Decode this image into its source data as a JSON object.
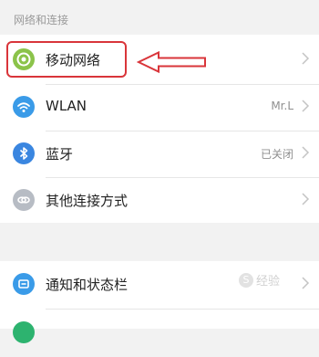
{
  "section": {
    "header": "网络和连接"
  },
  "rows": [
    {
      "label": "移动网络",
      "value": "",
      "icon": "mobile-network-icon",
      "color": "#8bc34a"
    },
    {
      "label": "WLAN",
      "value": "Mr.L",
      "icon": "wifi-icon",
      "color": "#3a9be8"
    },
    {
      "label": "蓝牙",
      "value": "已关闭",
      "icon": "bluetooth-icon",
      "color": "#3a86e0"
    },
    {
      "label": "其他连接方式",
      "value": "",
      "icon": "link-icon",
      "color": "#b7bcc4"
    }
  ],
  "rows2": [
    {
      "label": "通知和状态栏",
      "value": "",
      "icon": "notification-icon",
      "color": "#3a9be8"
    },
    {
      "label": "",
      "value": "",
      "icon": "partial-green-icon",
      "color": "#2db36f"
    }
  ],
  "annotation": {
    "highlight_color": "#d9353a"
  },
  "watermark": {
    "mark": "S",
    "text": "经验"
  }
}
